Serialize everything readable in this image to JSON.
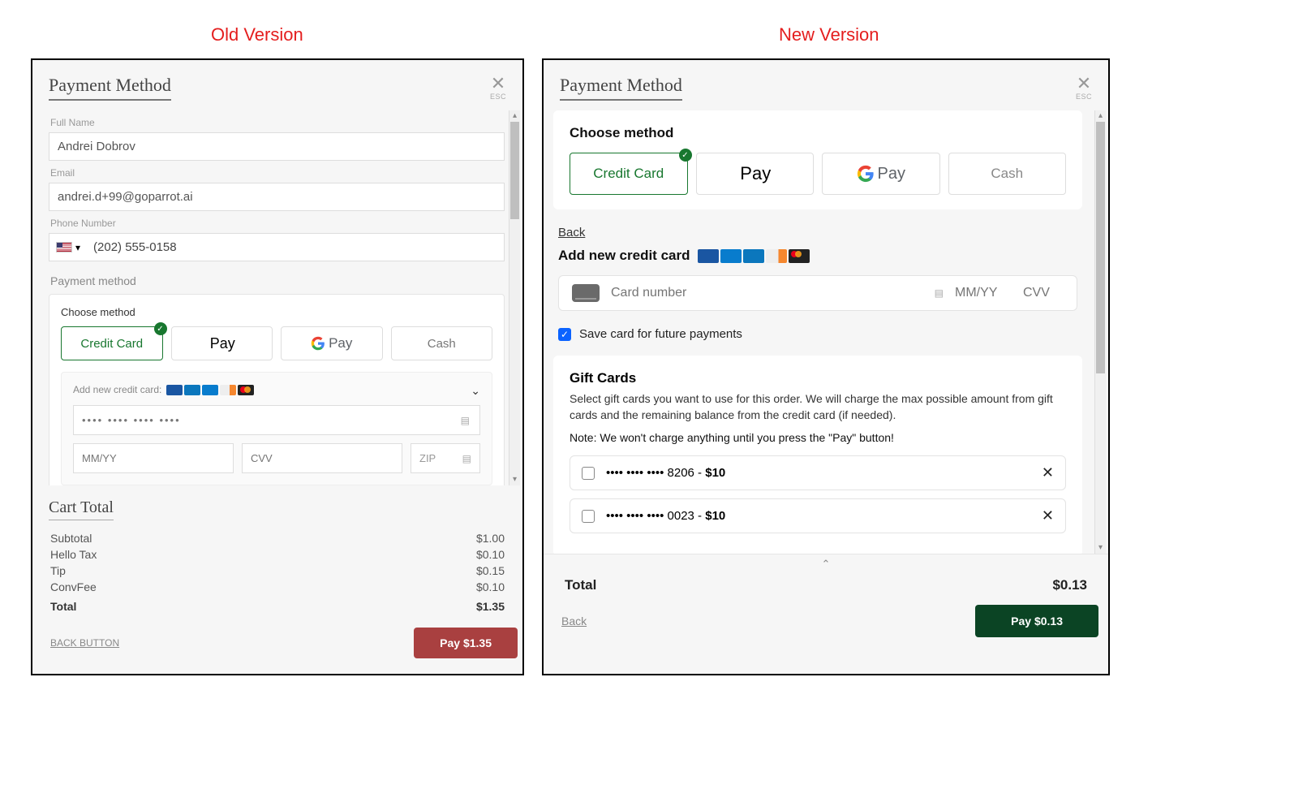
{
  "labels": {
    "old": "Old Version",
    "new": "New Version"
  },
  "old": {
    "title": "Payment Method",
    "esc": "ESC",
    "fullNameLabel": "Full Name",
    "fullName": "Andrei Dobrov",
    "emailLabel": "Email",
    "email": "andrei.d+99@goparrot.ai",
    "phoneLabel": "Phone Number",
    "phone": "(202) 555-0158",
    "pmLabel": "Payment method",
    "chooseLabel": "Choose method",
    "methods": [
      "Credit Card",
      "Pay",
      "Pay",
      "Cash"
    ],
    "addCardLabel": "Add new credit card:",
    "ccMask": "•••• •••• •••• ••••",
    "mmPlaceholder": "MM/YY",
    "cvvPlaceholder": "CVV",
    "zipPlaceholder": "ZIP",
    "cartTitle": "Cart Total",
    "lines": [
      {
        "label": "Subtotal",
        "value": "$1.00"
      },
      {
        "label": "Hello Tax",
        "value": "$0.10"
      },
      {
        "label": "Tip",
        "value": "$0.15"
      },
      {
        "label": "ConvFee",
        "value": "$0.10"
      }
    ],
    "total": {
      "label": "Total",
      "value": "$1.35"
    },
    "backButton": "BACK BUTTON",
    "payLabel": "Pay $1.35"
  },
  "new": {
    "title": "Payment Method",
    "esc": "ESC",
    "chooseLabel": "Choose method",
    "methods": [
      "Credit Card",
      "Pay",
      "Pay",
      "Cash"
    ],
    "back": "Back",
    "addCardLabel": "Add new credit card",
    "ccPlaceholder": "Card number",
    "mmPlaceholder": "MM/YY",
    "cvvPlaceholder": "CVV",
    "saveLabel": "Save card for future payments",
    "gc": {
      "title": "Gift Cards",
      "desc": "Select gift cards you want to use for this order. We will charge the max possible amount from gift cards and the remaining balance from the credit card (if needed).",
      "note": "Note: We won't charge anything until you press the \"Pay\" button!",
      "cards": [
        {
          "mask": "•••• •••• •••• 8206 - ",
          "amount": "$10"
        },
        {
          "mask": "•••• •••• •••• 0023 - ",
          "amount": "$10"
        }
      ]
    },
    "totalLabel": "Total",
    "totalValue": "$0.13",
    "backFooter": "Back",
    "payLabel": "Pay $0.13"
  }
}
